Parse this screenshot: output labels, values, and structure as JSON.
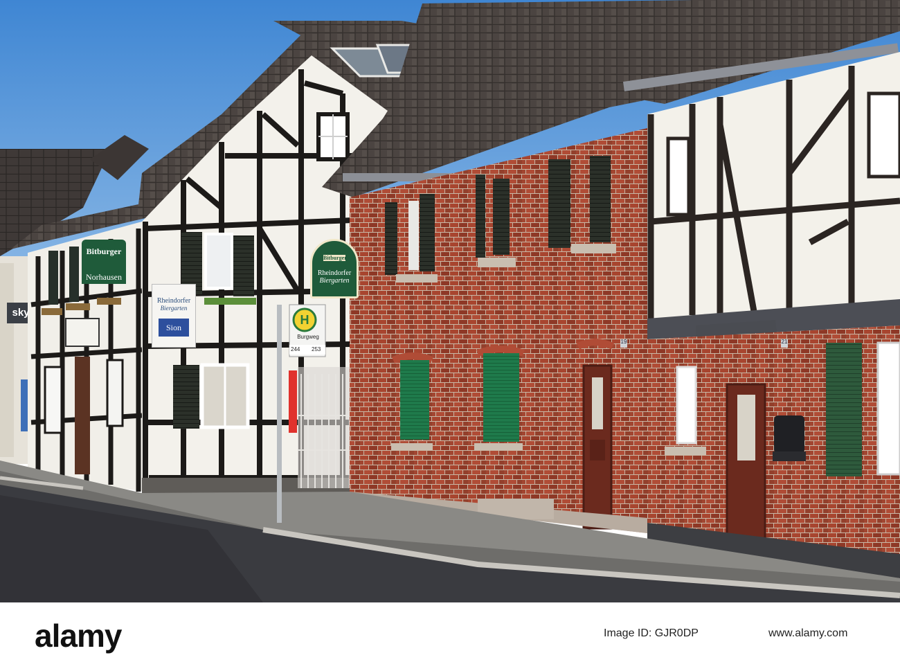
{
  "signs": {
    "bitburger_top": "Bitburger",
    "norhausen": "Norhausen",
    "rheindorfer_small": "Rheindorfer",
    "biergarten_small": "Biergarten",
    "sion": "Sion",
    "sky": "sky",
    "hanging_brand": "Bitburger",
    "hanging_line1": "Rheindorfer",
    "hanging_line2": "Biergarten",
    "bus_stop_letter": "H",
    "bus_stop_name": "Burgweg",
    "route_a": "244",
    "route_b": "253",
    "house_number_19": "19",
    "house_number_21": "21"
  },
  "watermark": {
    "logo": "alamy",
    "image_id": "Image ID: GJR0DP",
    "url": "www.alamy.com"
  },
  "colors": {
    "sky": "#4a8fd6",
    "brick": "#9a3e2c",
    "roof": "#4a4340",
    "timber": "#1c1a18",
    "plaster": "#f2f0ea",
    "shutter_green": "#2f5a3d",
    "street": "#3a3b40"
  }
}
